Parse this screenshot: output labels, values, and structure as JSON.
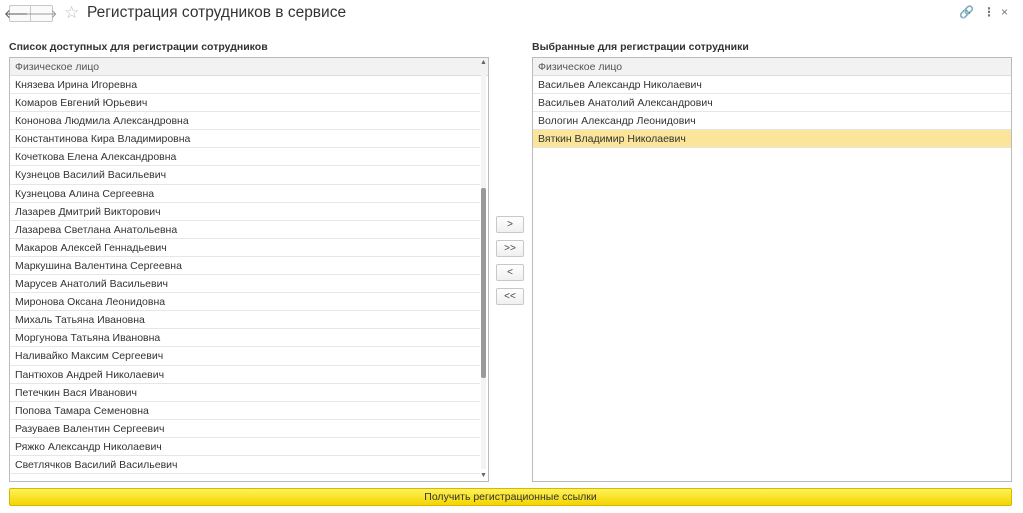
{
  "header": {
    "title": "Регистрация сотрудников в сервисе",
    "back_glyph": "🡐",
    "forward_glyph": "🡒",
    "star_glyph": "☆",
    "link_glyph": "🔗",
    "more_glyph": "⋮",
    "close_glyph": "×"
  },
  "available": {
    "title": "Список доступных для регистрации сотрудников",
    "column": "Физическое лицо",
    "rows": [
      "Князева Ирина Игоревна",
      "Комаров Евгений Юрьевич",
      "Кононова Людмила Александровна",
      "Константинова Кира Владимировна",
      "Кочеткова Елена Александровна",
      "Кузнецов Василий Васильевич",
      "Кузнецова Алина Сергеевна",
      "Лазарев Дмитрий Викторович",
      "Лазарева Светлана Анатольевна",
      "Макаров Алексей Геннадьевич",
      "Маркушина Валентина Сергеевна",
      "Марусев Анатолий Васильевич",
      "Миронова Оксана Леонидовна",
      "Михаль Татьяна Ивановна",
      "Моргунова Татьяна Ивановна",
      "Наливайко Максим Сергеевич",
      "Пантюхов Андрей Николаевич",
      "Петечкин Вася Иванович",
      "Попова Тамара Семеновна",
      "Разуваев Валентин Сергеевич",
      "Ряжко Александр Николаевич",
      "Светлячков Василий Васильевич"
    ]
  },
  "selected": {
    "title": "Выбранные для регистрации сотрудники",
    "column": "Физическое лицо",
    "rows": [
      "Васильев Александр Николаевич",
      "Васильев Анатолий Александрович",
      "Вологин Александр Леонидович",
      "Вяткин Владимир Николаевич"
    ],
    "active_index": 3
  },
  "transfer": {
    "add_one": ">",
    "add_all": ">>",
    "remove_one": "<",
    "remove_all": "<<"
  },
  "footer": {
    "get_links_label": "Получить регистрационные ссылки"
  }
}
